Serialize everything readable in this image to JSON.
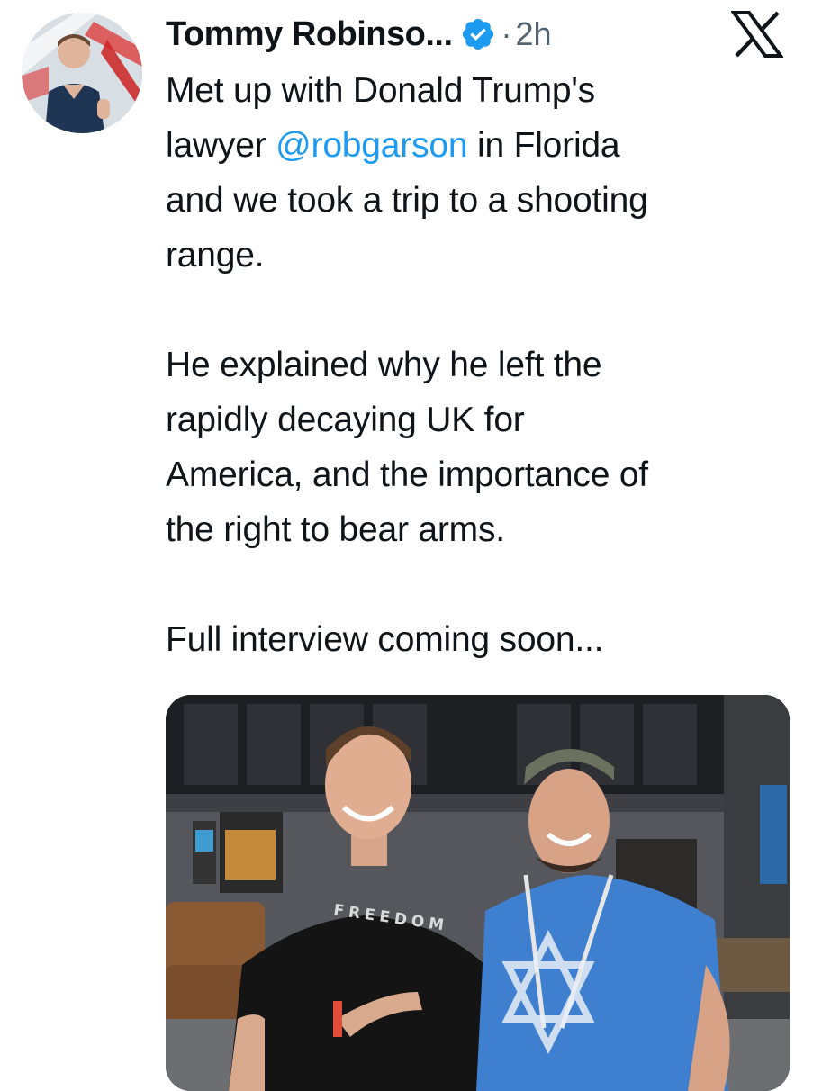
{
  "tweet": {
    "author": {
      "display_name": "Tommy Robinso...",
      "verified": true
    },
    "separator": "·",
    "timestamp": "2h",
    "paragraphs": [
      {
        "before": "Met up with Donald Trump's",
        "line2_start": "lawyer ",
        "mention": "@robgarson",
        "after": " in Florida",
        "line3": "and we took a trip to a shooting",
        "line4": "range."
      },
      {
        "lines": [
          "He explained why he left the",
          "rapidly decaying UK for",
          "America, and the importance of",
          "the right to bear arms."
        ]
      },
      {
        "lines": [
          "Full interview coming soon..."
        ]
      }
    ],
    "media": {
      "shirt_text": "FREEDOM"
    }
  },
  "icons": {
    "verified": "verified-badge-icon",
    "platform": "x-logo-icon"
  },
  "colors": {
    "accent": "#1d9bf0",
    "text": "#0f1419",
    "muted": "#536471"
  }
}
